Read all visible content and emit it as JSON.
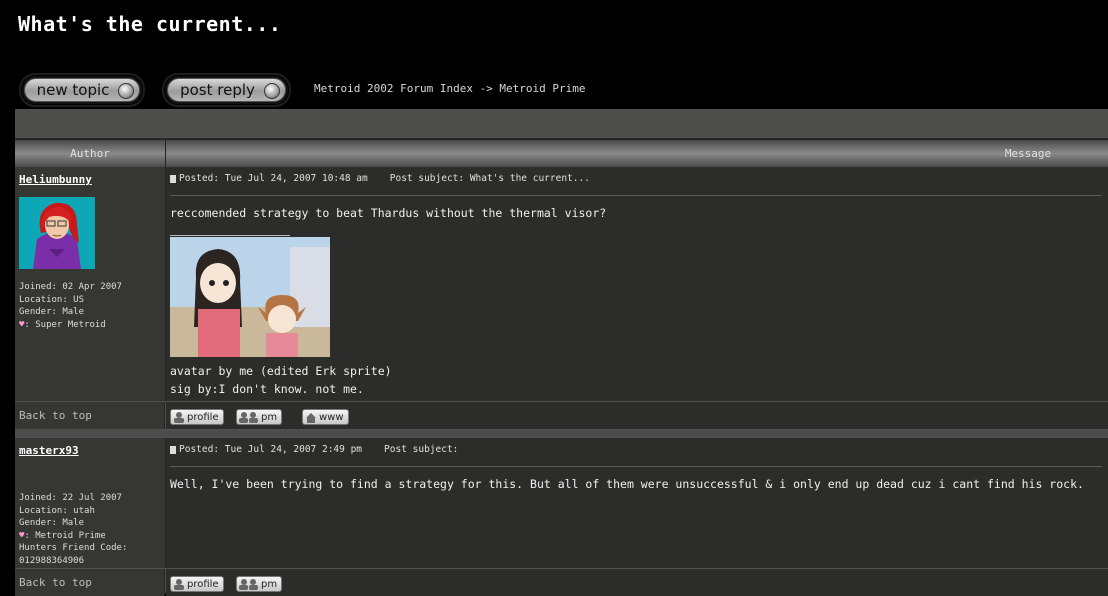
{
  "page": {
    "title": "What's the current...",
    "breadcrumb": "Metroid 2002 Forum Index -> Metroid Prime"
  },
  "buttons": {
    "new_topic": "new topic",
    "post_reply": "post reply"
  },
  "table": {
    "col_author": "Author",
    "col_message": "Message"
  },
  "posts": [
    {
      "username": "Heliumbunny",
      "joined": "Joined: 02 Apr 2007",
      "location": "Location: US",
      "gender": "Gender: Male",
      "fav": ": Super Metroid",
      "posted": "Posted: Tue Jul 24, 2007 10:48 am",
      "subject": "Post subject: What's the current...",
      "body": "reccomended strategy to beat Thardus without the thermal visor?",
      "sig_line1": "avatar by me (edited Erk sprite)",
      "sig_line2": "sig by:I don't know. not me.",
      "back_to_top": "Back to top",
      "btn_profile": "profile",
      "btn_pm": "pm",
      "btn_www": "www"
    },
    {
      "username": "masterx93",
      "joined": "Joined: 22 Jul 2007",
      "location": "Location: utah",
      "gender": "Gender: Male",
      "fav": ": Metroid Prime",
      "friend_code_label": "Hunters Friend Code:",
      "friend_code": "012988364906",
      "posted": "Posted: Tue Jul 24, 2007 2:49 pm",
      "subject": "Post subject:",
      "body": "Well, I've been trying to find a strategy for this. But all of them were unsuccessful & i only end up dead cuz i cant find his rock.",
      "back_to_top": "Back to top",
      "btn_profile": "profile",
      "btn_pm": "pm"
    }
  ],
  "icons": [
    "post-doc-icon",
    "heart-icon",
    "profile-icon",
    "pm-icon",
    "www-icon"
  ]
}
